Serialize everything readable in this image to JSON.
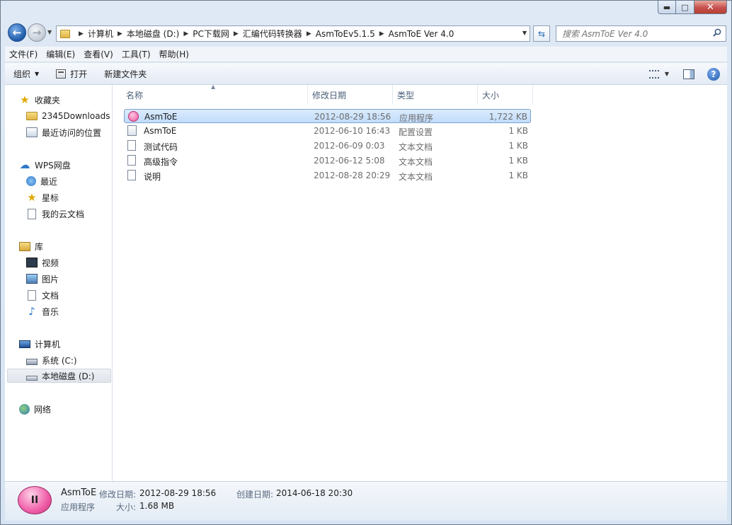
{
  "window": {
    "controls": {
      "minimize": "▬",
      "maximize": "□",
      "close": "✕"
    }
  },
  "address": {
    "crumbs": [
      "计算机",
      "本地磁盘 (D:)",
      "PC下载网",
      "汇编代码转换器",
      "AsmToEv5.1.5",
      "AsmToE Ver 4.0"
    ]
  },
  "search": {
    "placeholder": "搜索 AsmToE Ver 4.0"
  },
  "menubar": [
    "文件(F)",
    "编辑(E)",
    "查看(V)",
    "工具(T)",
    "帮助(H)"
  ],
  "commandbar": {
    "organize": "组织",
    "open": "打开",
    "new_folder": "新建文件夹"
  },
  "sidebar": {
    "favorites": {
      "label": "收藏夹",
      "items": [
        "2345Downloads",
        "最近访问的位置"
      ]
    },
    "wps": {
      "label": "WPS网盘",
      "items": [
        "最近",
        "星标",
        "我的云文档"
      ]
    },
    "libraries": {
      "label": "库",
      "items": [
        "视频",
        "图片",
        "文档",
        "音乐"
      ]
    },
    "computer": {
      "label": "计算机",
      "items": [
        "系统 (C:)",
        "本地磁盘 (D:)"
      ]
    },
    "network": {
      "label": "网络"
    }
  },
  "columns": {
    "name": "名称",
    "date": "修改日期",
    "type": "类型",
    "size": "大小"
  },
  "files": [
    {
      "name": "AsmToE",
      "date": "2012-08-29 18:56",
      "type": "应用程序",
      "size": "1,722 KB",
      "icon": "app-icon"
    },
    {
      "name": "AsmToE",
      "date": "2012-06-10 16:43",
      "type": "配置设置",
      "size": "1 KB",
      "icon": "config-file-icon"
    },
    {
      "name": "测试代码",
      "date": "2012-06-09 0:03",
      "type": "文本文档",
      "size": "1 KB",
      "icon": "text-file-icon"
    },
    {
      "name": "高级指令",
      "date": "2012-06-12 5:08",
      "type": "文本文档",
      "size": "1 KB",
      "icon": "text-file-icon"
    },
    {
      "name": "说明",
      "date": "2012-08-28 20:29",
      "type": "文本文档",
      "size": "1 KB",
      "icon": "text-file-icon"
    }
  ],
  "details": {
    "name": "AsmToE",
    "modified_label": "修改日期:",
    "modified": "2012-08-29 18:56",
    "created_label": "创建日期:",
    "created": "2014-06-18 20:30",
    "type": "应用程序",
    "size_label": "大小:",
    "size": "1.68 MB"
  },
  "colors": {
    "selection": "#cce4fc",
    "accent": "#1e5aa8",
    "app_icon": "#ef5ea8"
  }
}
